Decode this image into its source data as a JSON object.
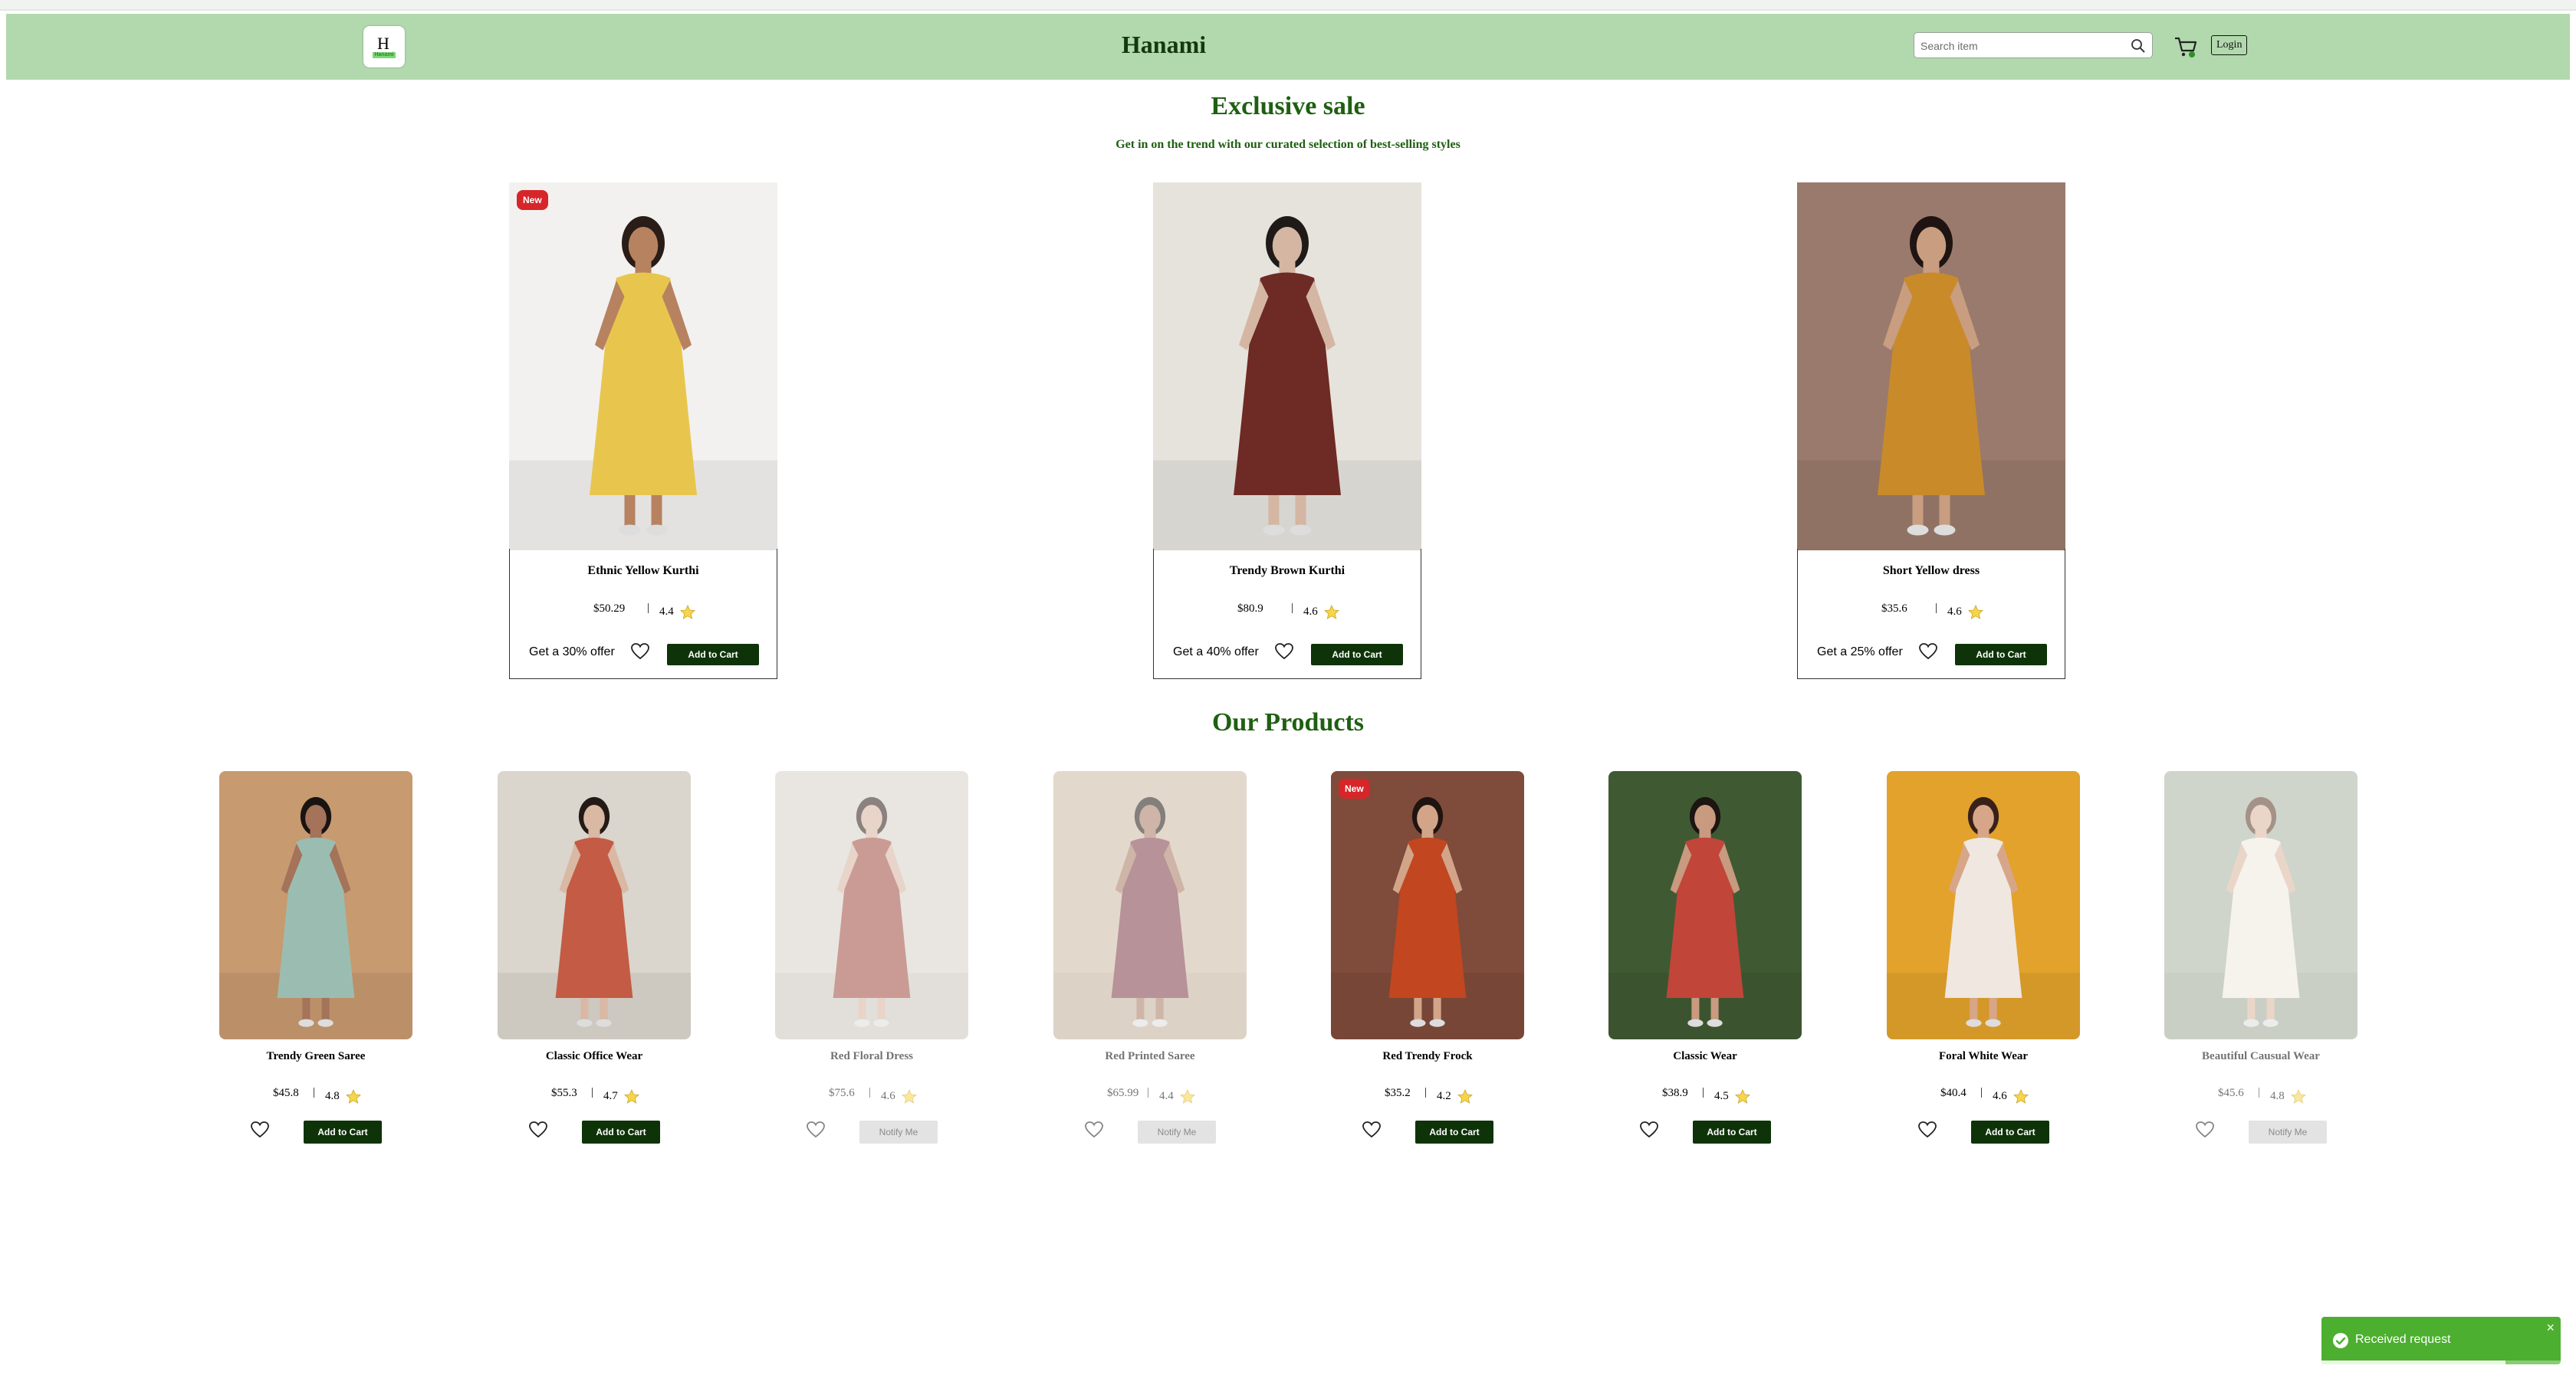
{
  "header": {
    "logo_text": "H",
    "logo_word": "Hanami",
    "brand": "Hanami",
    "search_placeholder": "Search item",
    "login_label": "Login"
  },
  "sale": {
    "title": "Exclusive sale",
    "subtitle": "Get in on the trend with our curated selection of best-selling styles",
    "items": [
      {
        "name": "Ethnic Yellow Kurthi",
        "price": "$50.29",
        "sep": "|",
        "rating": "4.4",
        "offer": "Get a 30% offer",
        "badge": "New",
        "button": "Add to Cart",
        "colors": {
          "bg": "#f2f1ef",
          "dress": "#e8c64e",
          "skin": "#b78260",
          "hair": "#2a1c16"
        }
      },
      {
        "name": "Trendy Brown Kurthi",
        "price": "$80.9",
        "sep": "|",
        "rating": "4.6",
        "offer": "Get a 40% offer",
        "badge": "",
        "button": "Add to Cart",
        "colors": {
          "bg": "#e5e3dc",
          "dress": "#6e2a24",
          "skin": "#d4b6a3",
          "hair": "#1f1a18"
        }
      },
      {
        "name": "Short Yellow dress",
        "price": "$35.6",
        "sep": "|",
        "rating": "4.6",
        "offer": "Get a 25% offer",
        "badge": "",
        "button": "Add to Cart",
        "colors": {
          "bg": "#9a7a6c",
          "dress": "#c98a2a",
          "skin": "#c99d80",
          "hair": "#1f1412"
        }
      }
    ]
  },
  "products": {
    "title": "Our Products",
    "items": [
      {
        "name": "Trendy Green Saree",
        "price": "$45.8",
        "sep": "|",
        "rating": "4.8",
        "badge": "",
        "button": "Add to Cart",
        "available": true,
        "colors": {
          "bg": "#c79a6f",
          "dress": "#9bbdb1",
          "skin": "#a4735a",
          "hair": "#1a1411"
        }
      },
      {
        "name": "Classic Office Wear",
        "price": "$55.3",
        "sep": "|",
        "rating": "4.7",
        "badge": "",
        "button": "Add to Cart",
        "available": true,
        "colors": {
          "bg": "#dad5cd",
          "dress": "#c35b45",
          "skin": "#d9b8a4",
          "hair": "#231a17"
        }
      },
      {
        "name": "Red Floral Dress",
        "price": "$75.6",
        "sep": "|",
        "rating": "4.6",
        "badge": "",
        "button": "Notify Me",
        "available": false,
        "colors": {
          "bg": "#d8d2c9",
          "dress": "#9f4b3d",
          "skin": "#d6b29d",
          "hair": "#2a1d18"
        }
      },
      {
        "name": "Red Printed Saree",
        "price": "$65.99",
        "sep": "|",
        "rating": "4.4",
        "badge": "",
        "button": "Notify Me",
        "available": false,
        "colors": {
          "bg": "#cdb9a3",
          "dress": "#7d3a45",
          "skin": "#a97a60",
          "hair": "#1f1714"
        }
      },
      {
        "name": "Red Trendy Frock",
        "price": "$35.2",
        "sep": "|",
        "rating": "4.2",
        "badge": "New",
        "button": "Add to Cart",
        "available": true,
        "colors": {
          "bg": "#7f4b3b",
          "dress": "#c2461f",
          "skin": "#d2a589",
          "hair": "#1f1410"
        }
      },
      {
        "name": "Classic Wear",
        "price": "$38.9",
        "sep": "|",
        "rating": "4.5",
        "badge": "",
        "button": "Add to Cart",
        "available": true,
        "colors": {
          "bg": "#3f5a32",
          "dress": "#c2453a",
          "skin": "#c89a80",
          "hair": "#1c1512"
        }
      },
      {
        "name": "Foral White Wear",
        "price": "$40.4",
        "sep": "|",
        "rating": "4.6",
        "badge": "",
        "button": "Add to Cart",
        "available": true,
        "colors": {
          "bg": "#e2a22c",
          "dress": "#efe7e0",
          "skin": "#d7a688",
          "hair": "#3a2117"
        }
      },
      {
        "name": "Beautiful Causual Wear",
        "price": "$45.6",
        "sep": "|",
        "rating": "4.8",
        "badge": "",
        "button": "Notify Me",
        "available": false,
        "colors": {
          "bg": "#a9b3a2",
          "dress": "#efeae0",
          "skin": "#d9b59c",
          "hair": "#5a3a27"
        }
      }
    ]
  },
  "toast": {
    "message": "Received request",
    "close": "×",
    "progress": 0.77
  },
  "icons": {
    "search": "search-icon",
    "cart": "cart-icon",
    "heart": "heart-icon",
    "star": "star-icon",
    "check": "check-circle-icon"
  },
  "colors": {
    "navbar": "#b1d9ad",
    "brand_text": "#16380f",
    "section_title": "#1f5f12",
    "button": "#0e3308",
    "badge": "#d6262a",
    "toast": "#4caf2f"
  }
}
